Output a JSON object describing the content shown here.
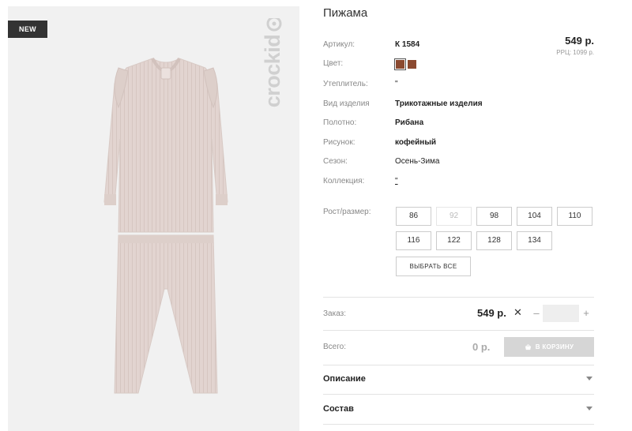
{
  "product": {
    "badge": "NEW",
    "brand": "crockid",
    "title": "Пижама",
    "price": "549 р.",
    "rrp": "РРЦ: 1099 р.",
    "swatch_color": "#8b4a30"
  },
  "attributes": {
    "article_label": "Артикул:",
    "article_value": "К 1584",
    "color_label": "Цвет:",
    "insulation_label": "Утеплитель:",
    "insulation_value": "\"",
    "type_label": "Вид изделия",
    "type_value": "Трикотажные изделия",
    "fabric_label": "Полотно:",
    "fabric_value": "Рибана",
    "pattern_label": "Рисунок:",
    "pattern_value": "кофейный",
    "season_label": "Сезон:",
    "season_value": "Осень-Зима",
    "collection_label": "Коллекция:",
    "collection_value": "\""
  },
  "sizes": {
    "label": "Рост/размер:",
    "options": [
      "86",
      "92",
      "98",
      "104",
      "110",
      "116",
      "122",
      "128",
      "134"
    ],
    "disabled": [
      "92"
    ],
    "select_all": "ВЫБРАТЬ ВСЕ"
  },
  "order": {
    "label": "Заказ:",
    "price": "549 р.",
    "times": "✕",
    "minus": "–",
    "plus": "+",
    "quantity": ""
  },
  "total": {
    "label": "Всего:",
    "value": "0 р.",
    "cart_button": "В КОРЗИНУ"
  },
  "accordions": {
    "description": "Описание",
    "composition": "Состав"
  },
  "colors": {
    "accent": "#8b4a30",
    "garment": "#e2d4d0",
    "cart_disabled": "#d6d6d6"
  }
}
